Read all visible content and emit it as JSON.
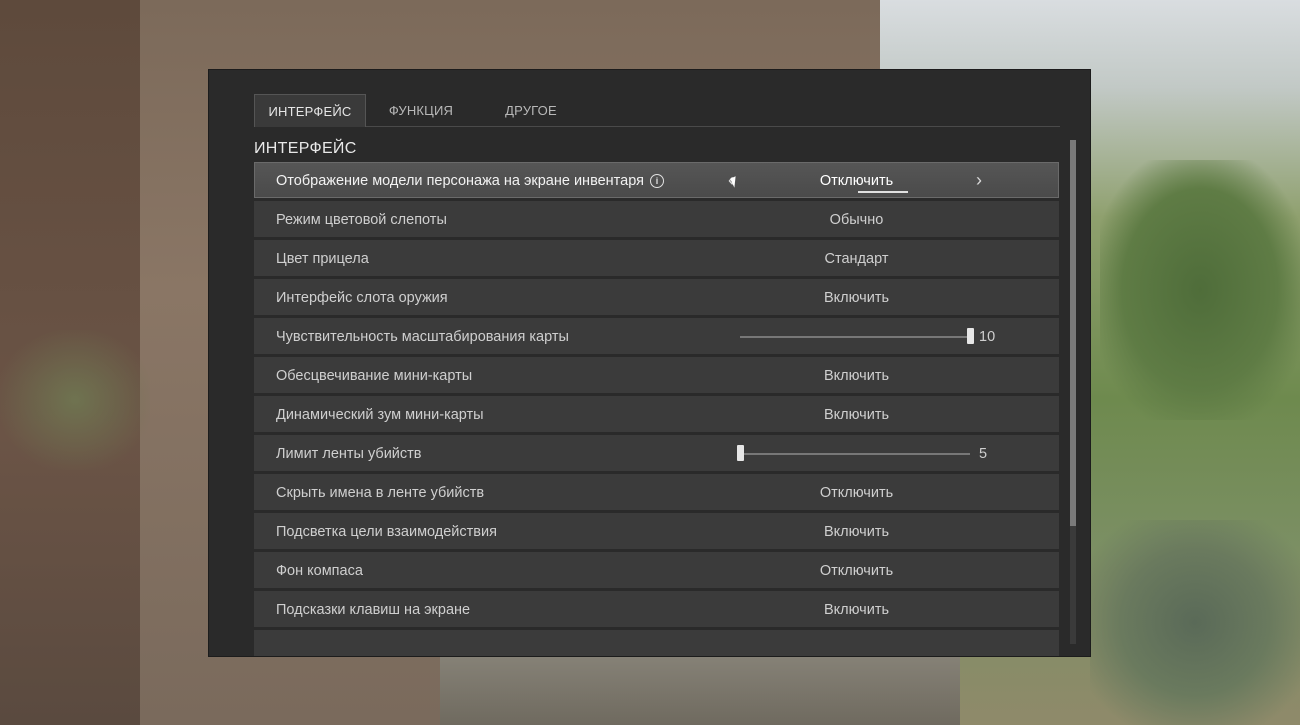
{
  "tabs": [
    {
      "label": "ИНТЕРФЕЙС",
      "active": true
    },
    {
      "label": "ФУНКЦИЯ",
      "active": false
    },
    {
      "label": "ДРУГОЕ",
      "active": false
    }
  ],
  "section_title": "ИНТЕРФЕЙС",
  "rows": [
    {
      "label": "Отображение модели персонажа на экране инвентаря",
      "value": "Отключить",
      "type": "selector",
      "active": true,
      "info_icon": "info-icon"
    },
    {
      "label": "Режим цветовой слепоты",
      "value": "Обычно",
      "type": "selector"
    },
    {
      "label": "Цвет прицела",
      "value": "Стандарт",
      "type": "selector"
    },
    {
      "label": "Интерфейс слота оружия",
      "value": "Включить",
      "type": "selector"
    },
    {
      "label": "Чувствительность масштабирования карты",
      "value": "10",
      "type": "slider",
      "level": 1.0
    },
    {
      "label": "Обесцвечивание мини-карты",
      "value": "Включить",
      "type": "selector"
    },
    {
      "label": "Динамический зум мини-карты",
      "value": "Включить",
      "type": "selector"
    },
    {
      "label": "Лимит ленты убийств",
      "value": "5",
      "type": "slider",
      "level": 0.0
    },
    {
      "label": "Скрыть имена в ленте убийств",
      "value": "Отключить",
      "type": "selector"
    },
    {
      "label": "Подсветка цели взаимодействия",
      "value": "Включить",
      "type": "selector"
    },
    {
      "label": "Фон компаса",
      "value": "Отключить",
      "type": "selector"
    },
    {
      "label": "Подсказки клавиш на экране",
      "value": "Включить",
      "type": "selector"
    }
  ],
  "icons": {
    "prev": "chevron-left-icon",
    "next": "chevron-right-icon",
    "info": "info-icon",
    "cursor": "mouse-cursor-icon"
  },
  "colors": {
    "panel": "#2a2a2a",
    "row": "#3b3b3b",
    "row_active": "#505050",
    "text": "#cfcfcf"
  }
}
